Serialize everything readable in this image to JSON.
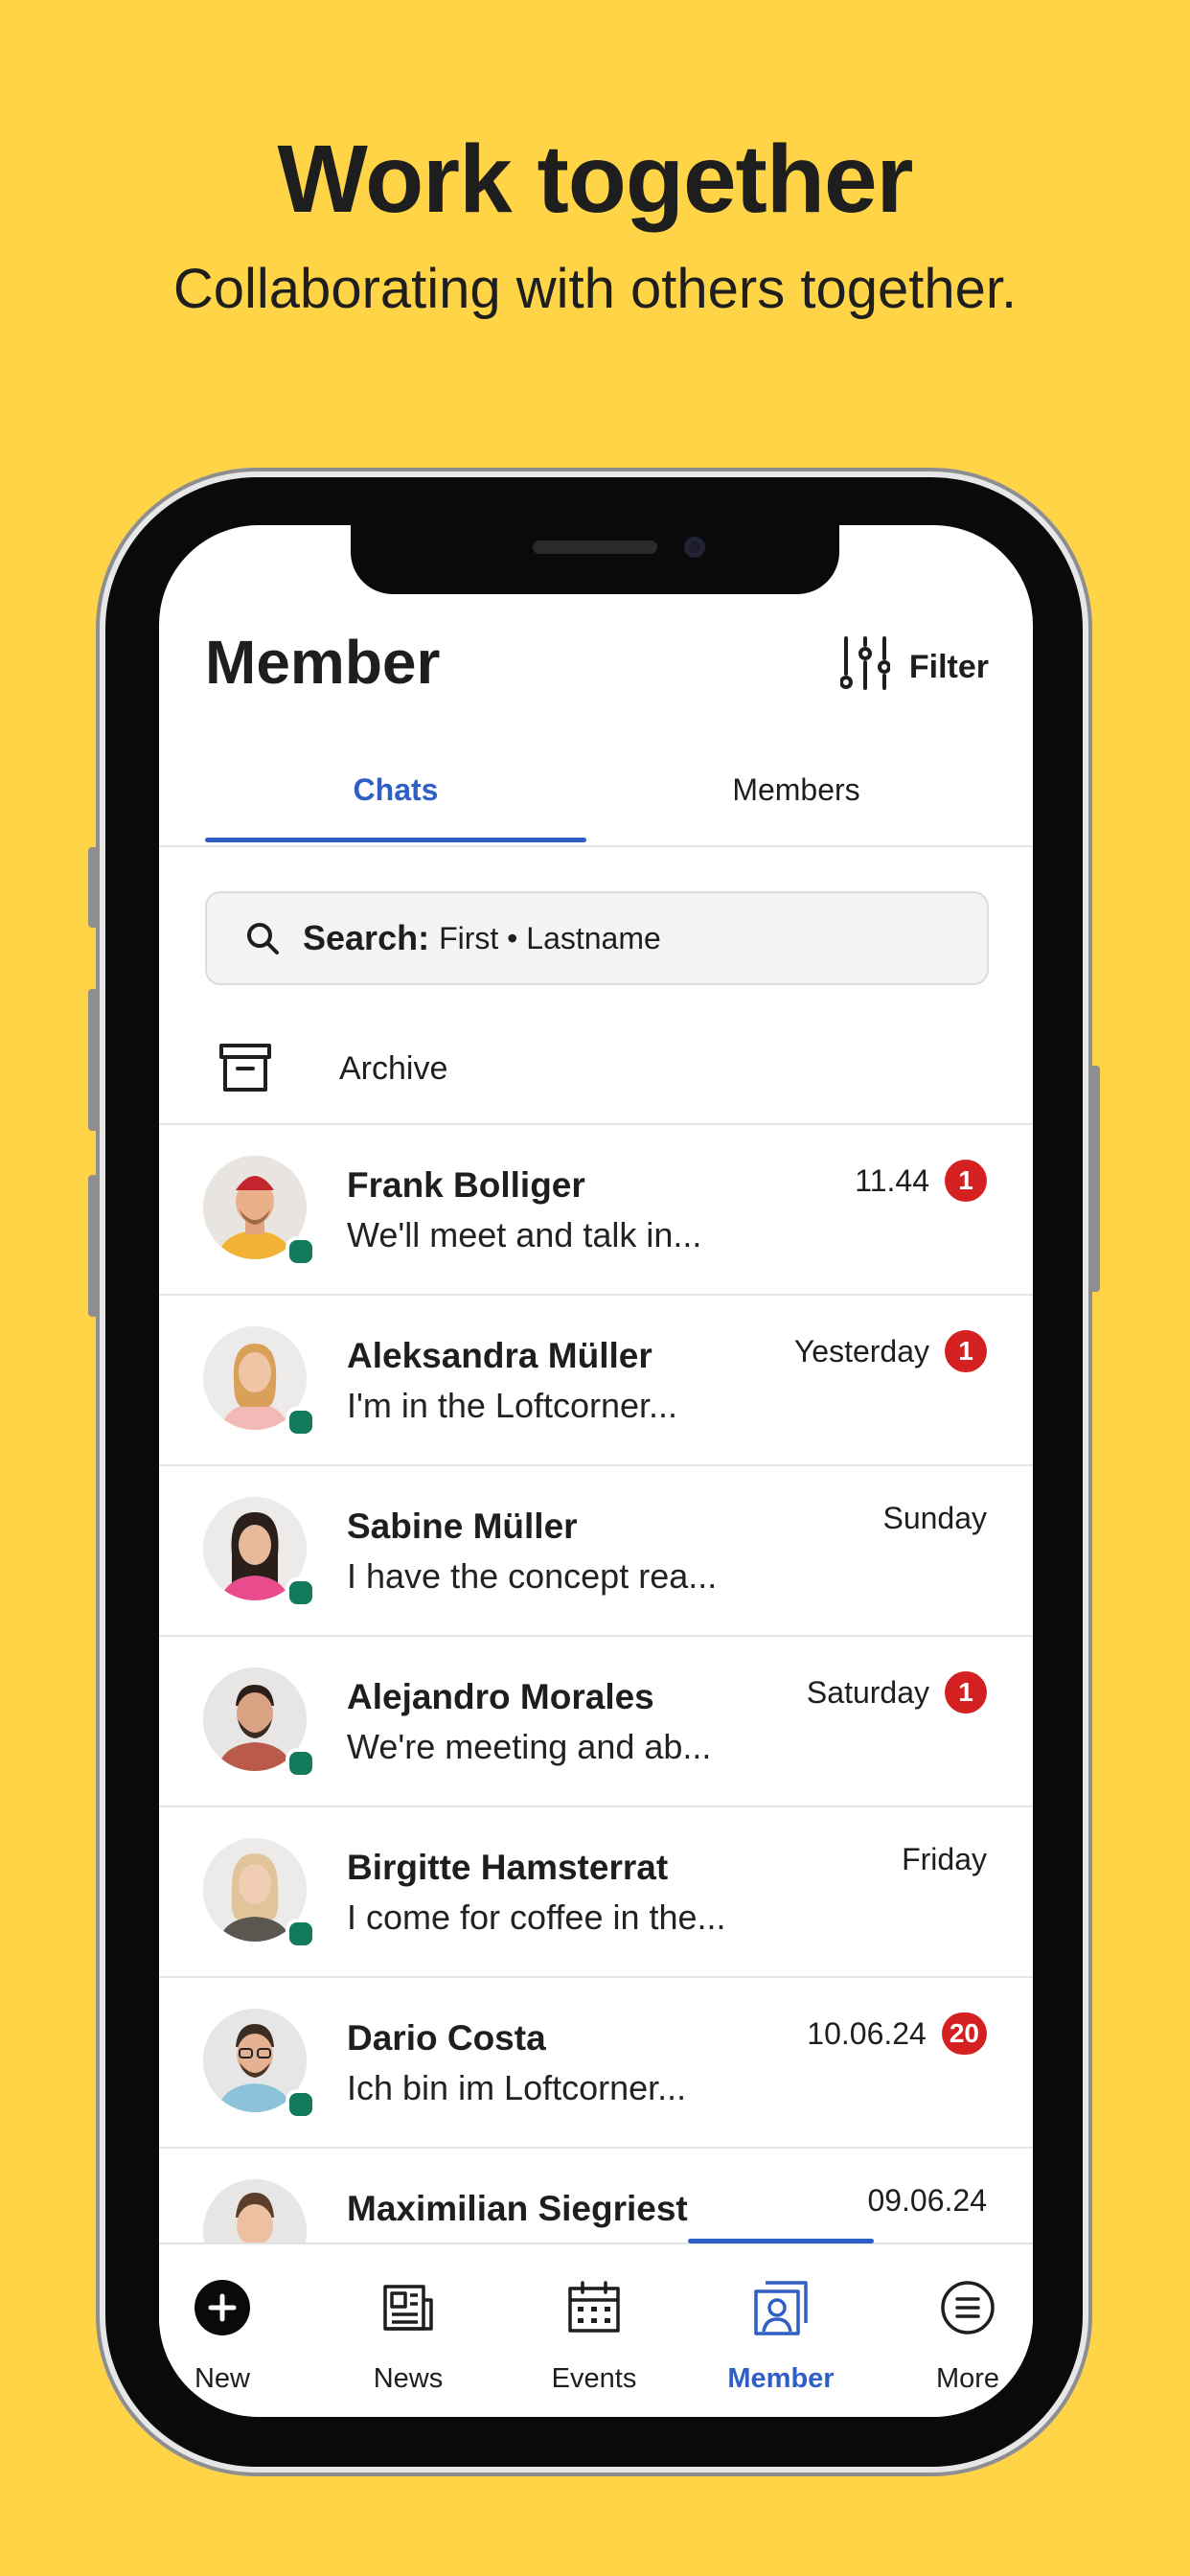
{
  "hero": {
    "title": "Work together",
    "subtitle": "Collaborating with others together."
  },
  "header": {
    "title": "Member",
    "filter_label": "Filter",
    "filter_icon": "sliders-icon"
  },
  "tabs": [
    {
      "label": "Chats",
      "active": true
    },
    {
      "label": "Members",
      "active": false
    }
  ],
  "search": {
    "label": "Search:",
    "placeholder": "First • Lastname",
    "icon": "search-icon"
  },
  "archive": {
    "label": "Archive",
    "icon": "archive-icon"
  },
  "chats": [
    {
      "name": "Frank Bolliger",
      "preview": "We'll meet and talk in...",
      "time": "11.44",
      "badge": "1",
      "online": true
    },
    {
      "name": "Aleksandra Müller",
      "preview": "I'm in the Loftcorner...",
      "time": "Yesterday",
      "badge": "1",
      "online": true
    },
    {
      "name": "Sabine Müller",
      "preview": "I have the concept rea...",
      "time": "Sunday",
      "badge": "",
      "online": true
    },
    {
      "name": "Alejandro Morales",
      "preview": "We're meeting and ab...",
      "time": "Saturday",
      "badge": "1",
      "online": true
    },
    {
      "name": "Birgitte Hamsterrat",
      "preview": "I come for coffee in the...",
      "time": "Friday",
      "badge": "",
      "online": true
    },
    {
      "name": "Dario Costa",
      "preview": "Ich bin im Loftcorner...",
      "time": "10.06.24",
      "badge": "20",
      "online": true
    },
    {
      "name": "Maximilian Siegriest",
      "preview": "",
      "time": "09.06.24",
      "badge": "",
      "online": false
    }
  ],
  "nav": [
    {
      "label": "New",
      "icon": "plus-circle-icon",
      "active": false
    },
    {
      "label": "News",
      "icon": "newspaper-icon",
      "active": false
    },
    {
      "label": "Events",
      "icon": "calendar-icon",
      "active": false
    },
    {
      "label": "Member",
      "icon": "members-icon",
      "active": true
    },
    {
      "label": "More",
      "icon": "menu-circle-icon",
      "active": false
    }
  ],
  "colors": {
    "background": "#FFD447",
    "accent": "#2F5FC4",
    "badge": "#D42020",
    "online": "#137A5C"
  }
}
